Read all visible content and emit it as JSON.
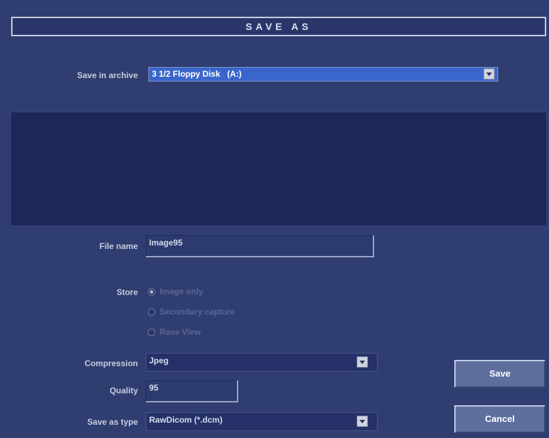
{
  "dialog": {
    "title": "SAVE AS"
  },
  "archive": {
    "label": "Save in archive",
    "value": "3 1/2 Floppy Disk   (A:)"
  },
  "file_name": {
    "label": "File name",
    "value": "Image95"
  },
  "store": {
    "label": "Store",
    "options": [
      {
        "label": "Image only",
        "checked": true
      },
      {
        "label": "Secondary capture",
        "checked": false
      },
      {
        "label": "Rave View",
        "checked": false
      }
    ]
  },
  "compression": {
    "label": "Compression",
    "value": "Jpeg"
  },
  "quality": {
    "label": "Quality",
    "value": "95"
  },
  "save_type": {
    "label": "Save as type",
    "value": "RawDicom  (*.dcm)"
  },
  "buttons": {
    "save": "Save",
    "cancel": "Cancel"
  },
  "colors": {
    "background": "#303d70",
    "selection": "#3a66cc",
    "list_area": "#1e2858"
  }
}
